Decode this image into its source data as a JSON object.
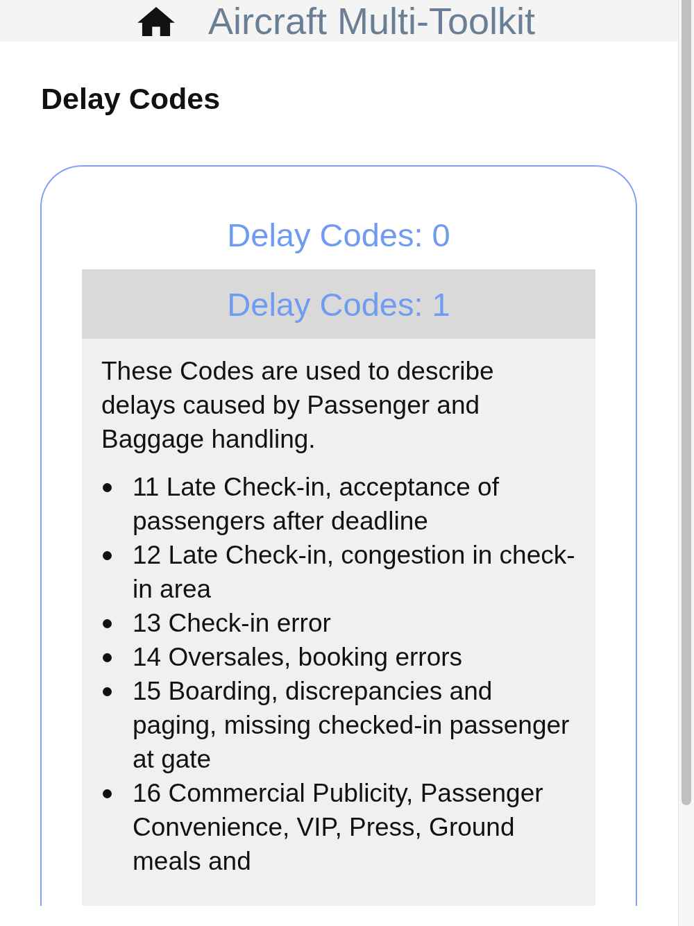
{
  "header": {
    "title": "Aircraft Multi-Toolkit"
  },
  "page_title": "Delay Codes",
  "sections": [
    {
      "title": "Delay Codes: 0",
      "expanded": false
    },
    {
      "title": "Delay Codes: 1",
      "expanded": true,
      "description": "These Codes are used to describe delays caused by Passenger and Baggage handling.",
      "items": [
        "11 Late Check-in, acceptance of passengers after deadline",
        "12 Late Check-in, congestion in check-in area",
        "13 Check-in error",
        "14 Oversales, booking errors",
        "15 Boarding, discrepancies and paging, missing checked-in passenger at gate",
        "16 Commercial Publicity, Passenger Convenience, VIP, Press, Ground meals and"
      ]
    }
  ]
}
